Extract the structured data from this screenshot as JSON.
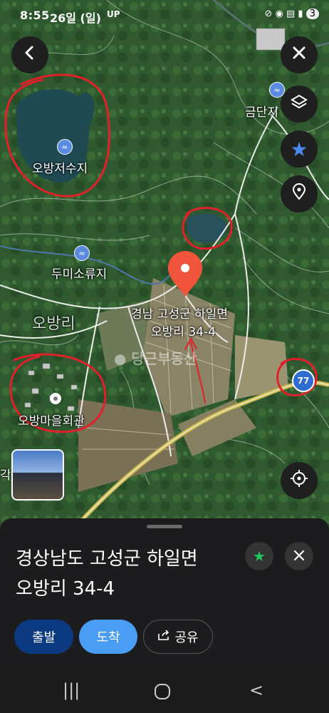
{
  "status_bar": {
    "time": "8:55",
    "date": "26일 (일)",
    "left_icons": "UP",
    "battery": "3"
  },
  "map": {
    "labels": {
      "reservoir": "오방저수지",
      "geumdan": "금단지",
      "dumi": "두미소류지",
      "obangri": "오방리",
      "hall": "오방마을회관",
      "pin_line1": "경남 고성군 하일면",
      "pin_line2": "오방리 34-4",
      "watermark": "당근부동산",
      "left_cut": "각"
    },
    "route_number": "77",
    "colors": {
      "pin": "#f0553c",
      "annotation": "#e0202a"
    }
  },
  "place": {
    "address_line1": "경상남도 고성군 하일면",
    "address_line2": "오방리 34-4"
  },
  "actions": {
    "depart": "출발",
    "arrive": "도착",
    "share": "공유"
  },
  "icons": {
    "back": "back-arrow-icon",
    "close": "close-icon",
    "layers": "layers-icon",
    "favorite": "star-icon",
    "place": "location-pin-icon",
    "locate": "crosshair-icon"
  }
}
